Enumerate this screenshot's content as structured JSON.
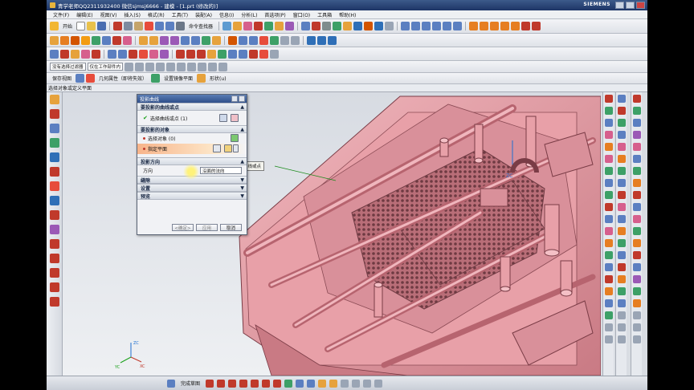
{
  "window": {
    "title": "青学老师QQ2311932400 微信sjmsj6666 - 建模 - [1.prt (修改的)]",
    "brand": "SIEMENS"
  },
  "menu": [
    "文件(F)",
    "编辑(E)",
    "视图(V)",
    "插入(S)",
    "格式(R)",
    "工具(T)",
    "装配(A)",
    "信息(I)",
    "分析(L)",
    "首选项(P)",
    "窗口(O)",
    "工具箱",
    "帮助(H)"
  ],
  "toolbar": {
    "start_label": "开始",
    "command_finder_label": "命令查找器",
    "filter_dropdown": "单个面",
    "select_filter": "没有选择过滤器",
    "assembly_scope": "仅在工作部件内",
    "geometry_label": "几何属性（即将失效）",
    "mirror_label": "设置镜像平面",
    "shape_label": "形状(u)",
    "save_view_label": "保存视图"
  },
  "selection_bar": "选择对象或定义平面",
  "dialog": {
    "title": "投影曲线",
    "section_curves": "要投影的曲线或点",
    "select_curves": "选择曲线或点 (1)",
    "section_objects": "要投影的对象",
    "select_object": "选择对象 (0)",
    "specify_plane": "指定平面",
    "section_direction": "投影方向",
    "direction_label": "方向",
    "direction_value": "沿面的法向",
    "gap": "缝隙",
    "settings": "设置",
    "preview": "预览",
    "ok": "<确定>",
    "apply": "应用",
    "cancel": "取消"
  },
  "tooltip": "要投影的曲线或点",
  "axis_labels": {
    "zc": "ZC",
    "xc": "XC",
    "yc": "YC"
  },
  "statusbar": {
    "label": "完成草图"
  },
  "colors": {
    "model": "#e8a0a8",
    "model_dark": "#b06670",
    "titlebar": "#2a4578"
  }
}
